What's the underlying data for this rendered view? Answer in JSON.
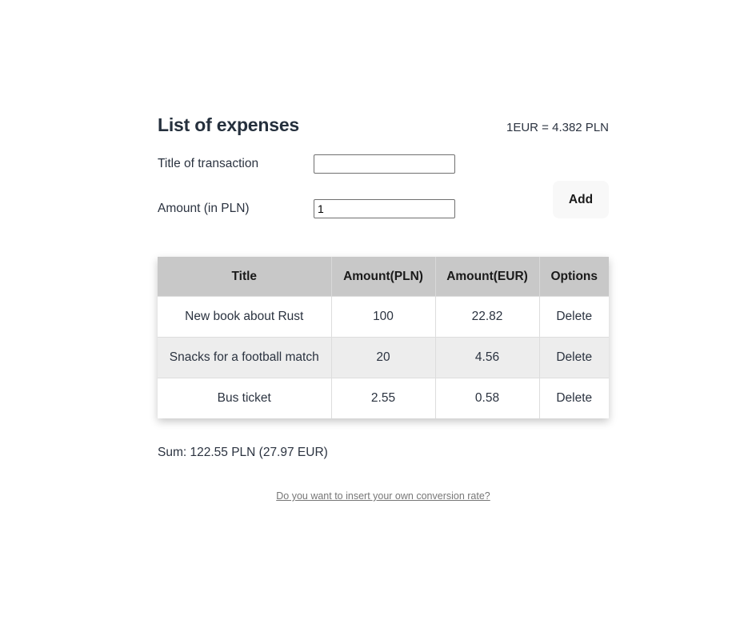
{
  "header": {
    "title": "List of expenses",
    "rate": "1EUR = 4.382 PLN"
  },
  "form": {
    "title_label": "Title of transaction",
    "title_value": "",
    "amount_label": "Amount (in PLN)",
    "amount_value": "1",
    "add_label": "Add"
  },
  "table": {
    "columns": [
      "Title",
      "Amount(PLN)",
      "Amount(EUR)",
      "Options"
    ],
    "rows": [
      {
        "title": "New book about Rust",
        "pln": "100",
        "eur": "22.82",
        "action": "Delete"
      },
      {
        "title": "Snacks for a football match",
        "pln": "20",
        "eur": "4.56",
        "action": "Delete"
      },
      {
        "title": "Bus ticket",
        "pln": "2.55",
        "eur": "0.58",
        "action": "Delete"
      }
    ]
  },
  "summary": {
    "sum": "Sum: 122.55 PLN (27.97 EUR)"
  },
  "footer": {
    "conversion_link": "Do you want to insert your own conversion rate?"
  }
}
